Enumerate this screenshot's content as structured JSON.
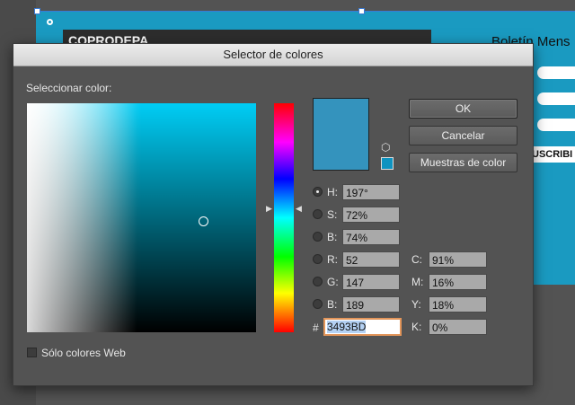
{
  "document": {
    "header_title": "COPRODEPA",
    "side_title": "Boletín Mens",
    "subscribe_label": "USCRIBI"
  },
  "dialog": {
    "title": "Selector de colores",
    "select_label": "Seleccionar color:",
    "buttons": {
      "ok": "OK",
      "cancel": "Cancelar",
      "swatches": "Muestras de color"
    },
    "color_hex_swatch": "#3493BD",
    "web_swatch_color": "#0e93c0",
    "fields": {
      "h": {
        "label": "H:",
        "value": "197°"
      },
      "s": {
        "label": "S:",
        "value": "72%"
      },
      "b_hsb": {
        "label": "B:",
        "value": "74%"
      },
      "r": {
        "label": "R:",
        "value": "52"
      },
      "g": {
        "label": "G:",
        "value": "147"
      },
      "b_rgb": {
        "label": "B:",
        "value": "189"
      },
      "c": {
        "label": "C:",
        "value": "91%"
      },
      "m": {
        "label": "M:",
        "value": "16%"
      },
      "y": {
        "label": "Y:",
        "value": "18%"
      },
      "k": {
        "label": "K:",
        "value": "0%"
      }
    },
    "hex": {
      "label": "#",
      "value": "3493BD"
    },
    "web_only_label": "Sólo colores Web"
  }
}
